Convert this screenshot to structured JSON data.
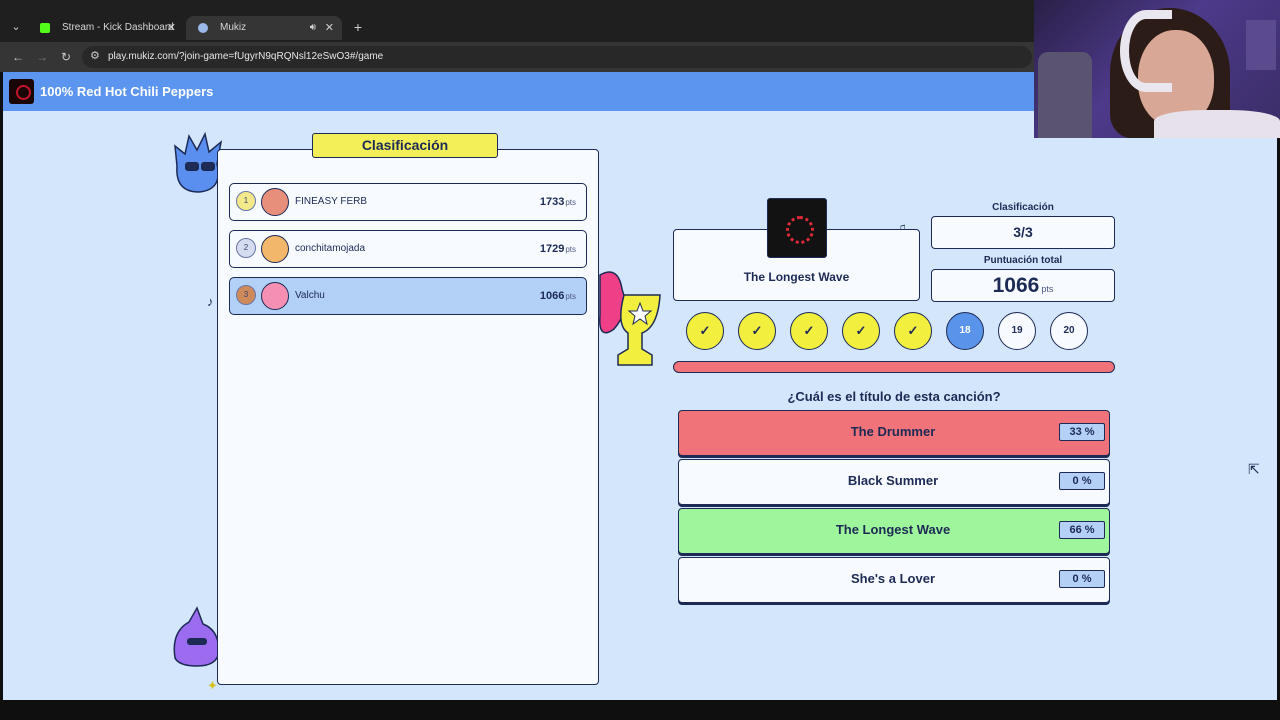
{
  "browser": {
    "tabs": [
      {
        "title": "Stream - Kick Dashboard",
        "favicon_color": "#53fc18"
      },
      {
        "title": "Mukiz",
        "favicon_color": "#9bb8e8"
      }
    ],
    "url": "play.mukiz.com/?join-game=fUgyrN9qRQNsl12eSwO3#/game"
  },
  "header": {
    "title": "100% Red Hot Chili Peppers"
  },
  "leaderboard": {
    "title": "Clasificación",
    "players": [
      {
        "rank": "1",
        "name": "FINEASY FERB",
        "score": "1733",
        "unit": "pts",
        "avatar_color": "#e78f7a"
      },
      {
        "rank": "2",
        "name": "conchitamojada",
        "score": "1729",
        "unit": "pts",
        "avatar_color": "#f2b76a"
      },
      {
        "rank": "3",
        "name": "Valchu",
        "score": "1066",
        "unit": "pts",
        "avatar_color": "#f590b4"
      }
    ]
  },
  "song": {
    "title": "The Longest Wave"
  },
  "stats": {
    "rank_label": "Clasificación",
    "rank_value": "3/3",
    "total_label": "Puntuación total",
    "total_value": "1066",
    "total_unit": "pts"
  },
  "progress": [
    {
      "label": "✓",
      "state": "done"
    },
    {
      "label": "✓",
      "state": "done"
    },
    {
      "label": "✓",
      "state": "done"
    },
    {
      "label": "✓",
      "state": "done"
    },
    {
      "label": "✓",
      "state": "done"
    },
    {
      "label": "18",
      "state": "current"
    },
    {
      "label": "19",
      "state": "future"
    },
    {
      "label": "20",
      "state": "future"
    }
  ],
  "question": "¿Cuál es el título de esta canción?",
  "answers": [
    {
      "text": "The Drummer",
      "percent": "33 %",
      "state": "wrong"
    },
    {
      "text": "Black Summer",
      "percent": "0 %",
      "state": "neutral"
    },
    {
      "text": "The Longest Wave",
      "percent": "66 %",
      "state": "correct"
    },
    {
      "text": "She's a Lover",
      "percent": "0 %",
      "state": "neutral"
    }
  ],
  "colors": {
    "header": "#5b95ef",
    "page_bg": "#d4e6fb",
    "wrong": "#ef7379",
    "correct": "#9ff59b",
    "neutral": "#f7fbff",
    "done_dot": "#f3ef3f",
    "current_dot": "#5a93ea"
  }
}
